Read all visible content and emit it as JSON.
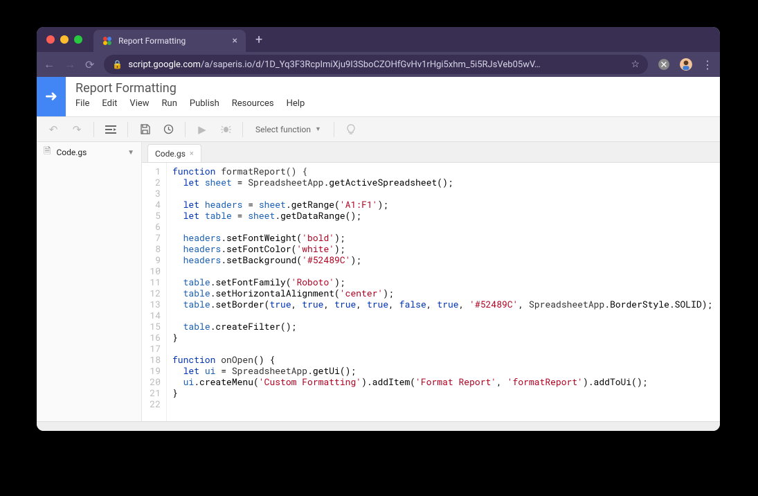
{
  "browser": {
    "tab_title": "Report Formatting",
    "url_host": "script.google.com",
    "url_path": "/a/saperis.io/d/1D_Yq3F3RcpImiXju9I3SboCZOHfGvHv1rHgi5xhm_5i5RJsVeb05wV…"
  },
  "header": {
    "project_title": "Report Formatting",
    "menus": [
      "File",
      "Edit",
      "View",
      "Run",
      "Publish",
      "Resources",
      "Help"
    ]
  },
  "toolbar": {
    "select_fn_label": "Select function"
  },
  "sidebar": {
    "file": "Code.gs"
  },
  "editor": {
    "tab": "Code.gs",
    "line_count": 22,
    "lines": {
      "l1_kw": "function",
      "l1_name": " formatReport",
      "l1_rest": "() {",
      "l2_kw": "let",
      "l2_v": "sheet",
      "l2_eq": " = ",
      "l2_obj": "SpreadsheetApp",
      "l2_m": ".getActiveSpreadsheet();",
      "l4_kw": "let",
      "l4_v": "headers",
      "l4_eq": " = ",
      "l4_obj": "sheet",
      "l4_m": ".getRange(",
      "l4_str": "'A1:F1'",
      "l4_end": ");",
      "l5_kw": "let",
      "l5_v": "table",
      "l5_eq": " = ",
      "l5_obj": "sheet",
      "l5_m": ".getDataRange();",
      "l7_obj": "headers",
      "l7_m": ".setFontWeight(",
      "l7_str": "'bold'",
      "l7_end": ");",
      "l8_obj": "headers",
      "l8_m": ".setFontColor(",
      "l8_str": "'white'",
      "l8_end": ");",
      "l9_obj": "headers",
      "l9_m": ".setBackground(",
      "l9_str": "'#52489C'",
      "l9_end": ");",
      "l11_obj": "table",
      "l11_m": ".setFontFamily(",
      "l11_str": "'Roboto'",
      "l11_end": ");",
      "l12_obj": "table",
      "l12_m": ".setHorizontalAlignment(",
      "l12_str": "'center'",
      "l12_end": ");",
      "l13_obj": "table",
      "l13_m": ".setBorder(",
      "l13_b1": "true",
      "l13_c1": ", ",
      "l13_b2": "true",
      "l13_c2": ", ",
      "l13_b3": "true",
      "l13_c3": ", ",
      "l13_b4": "true",
      "l13_c4": ", ",
      "l13_b5": "false",
      "l13_c5": ", ",
      "l13_b6": "true",
      "l13_c6": ", ",
      "l13_str": "'#52489C'",
      "l13_c7": ", ",
      "l13_sa": "SpreadsheetApp",
      "l13_end": ".BorderStyle.SOLID);",
      "l15_obj": "table",
      "l15_m": ".createFilter();",
      "l16_brace": "}",
      "l18_kw": "function",
      "l18_name": " onOpen",
      "l18_rest": "() {",
      "l19_kw": "let",
      "l19_v": "ui",
      "l19_eq": " = ",
      "l19_obj": "SpreadsheetApp",
      "l19_m": ".getUi();",
      "l20_obj": "ui",
      "l20_m1": ".createMenu(",
      "l20_s1": "'Custom Formatting'",
      "l20_m2": ").addItem(",
      "l20_s2": "'Format Report'",
      "l20_c": ", ",
      "l20_s3": "'formatReport'",
      "l20_m3": ").addToUi();",
      "l21_brace": "}"
    }
  }
}
